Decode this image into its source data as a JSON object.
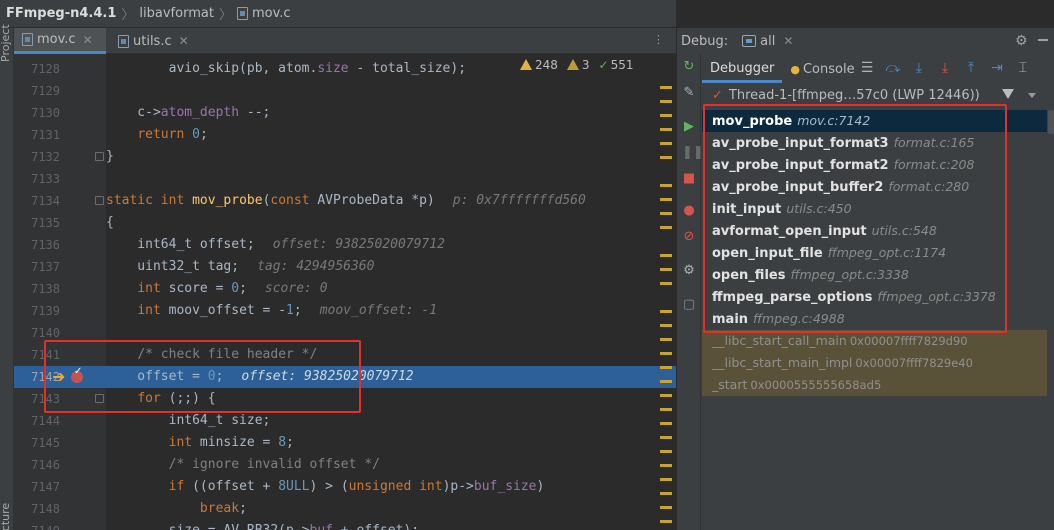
{
  "breadcrumb": {
    "project": "FFmpeg-n4.4.1",
    "folder": "libavformat",
    "file": "mov.c"
  },
  "side_strip": {
    "project_label": "Project",
    "bottom_label": "Structure"
  },
  "editor_tabs": [
    {
      "label": "mov.c",
      "active": true
    },
    {
      "label": "utils.c",
      "active": false
    }
  ],
  "inspections": {
    "warnings": "248",
    "weak_warnings": "3",
    "typos": "551"
  },
  "code_lines": [
    {
      "num": "7128",
      "html": "        avio_skip(pb, atom.<span class='field'>size</span> - total_size);"
    },
    {
      "num": "7129",
      "html": ""
    },
    {
      "num": "7130",
      "html": "    c-><span class='field'>atom_depth</span> --;"
    },
    {
      "num": "7131",
      "html": "    <span class='kw'>return</span> <span class='num'>0</span>;"
    },
    {
      "num": "7132",
      "html": "}"
    },
    {
      "num": "7133",
      "html": ""
    },
    {
      "num": "7134",
      "html": "<span class='kw'>static int</span> <span class='fn'>mov_probe</span>(<span class='kw'>const</span> AVProbeData *p)<span class='hint'>p: 0x7fffffffd560</span>"
    },
    {
      "num": "7135",
      "html": "{"
    },
    {
      "num": "7136",
      "html": "    int64_t offset;<span class='hint'>offset: 93825020079712</span>"
    },
    {
      "num": "7137",
      "html": "    uint32_t tag;<span class='hint'>tag: 4294956360</span>"
    },
    {
      "num": "7138",
      "html": "    <span class='kw'>int</span> score = <span class='num'>0</span>;<span class='hint'>score: 0</span>"
    },
    {
      "num": "7139",
      "html": "    <span class='kw'>int</span> moov_offset = -<span class='num'>1</span>;<span class='hint'>moov_offset: -1</span>"
    },
    {
      "num": "7140",
      "html": ""
    },
    {
      "num": "7141",
      "html": "    <span class='cm'>/* check file header */</span>"
    },
    {
      "num": "7142",
      "html": "    offset = <span class='num'>0</span>;<span class='hint'>offset: 93825020079712</span>"
    },
    {
      "num": "7143",
      "html": "    <span class='kw'>for</span> (;;) {"
    },
    {
      "num": "7144",
      "html": "        int64_t size;"
    },
    {
      "num": "7145",
      "html": "        <span class='kw'>int</span> minsize = <span class='num'>8</span>;"
    },
    {
      "num": "7146",
      "html": "        <span class='cm'>/* ignore invalid offset */</span>"
    },
    {
      "num": "7147",
      "html": "        <span class='kw'>if</span> ((offset + <span class='num'>8ULL</span>) > (<span class='kw'>unsigned int</span>)p-><span class='field'>buf_size</span>)"
    },
    {
      "num": "7148",
      "html": "            <span class='kw'>break</span>;"
    },
    {
      "num": "7149",
      "html": "        size = AV_RB32(p-><span class='field'>buf</span> + offset);"
    }
  ],
  "debug": {
    "title": "Debug:",
    "session": "all",
    "tabs": [
      "Debugger",
      "Console"
    ],
    "thread": "Thread-1-[ffmpeg…57c0 (LWP 12446))"
  },
  "frames": [
    {
      "name": "mov_probe",
      "loc": "mov.c:7142",
      "kind": "sel"
    },
    {
      "name": "av_probe_input_format3",
      "loc": "format.c:165",
      "kind": "user"
    },
    {
      "name": "av_probe_input_format2",
      "loc": "format.c:208",
      "kind": "user"
    },
    {
      "name": "av_probe_input_buffer2",
      "loc": "format.c:280",
      "kind": "user"
    },
    {
      "name": "init_input",
      "loc": "utils.c:450",
      "kind": "user"
    },
    {
      "name": "avformat_open_input",
      "loc": "utils.c:548",
      "kind": "user"
    },
    {
      "name": "open_input_file",
      "loc": "ffmpeg_opt.c:1174",
      "kind": "user"
    },
    {
      "name": "open_files",
      "loc": "ffmpeg_opt.c:3338",
      "kind": "user"
    },
    {
      "name": "ffmpeg_parse_options",
      "loc": "ffmpeg_opt.c:3378",
      "kind": "user"
    },
    {
      "name": "main",
      "loc": "ffmpeg.c:4988",
      "kind": "user"
    },
    {
      "name": "__libc_start_call_main",
      "loc": "0x00007ffff7829d90",
      "kind": "lib"
    },
    {
      "name": "__libc_start_main_impl",
      "loc": "0x00007ffff7829e40",
      "kind": "lib"
    },
    {
      "name": "_start",
      "loc": "0x0000555555658ad5",
      "kind": "lib"
    }
  ],
  "colors": {
    "highlight_line": "#2d6099",
    "selected_frame": "#0d293e",
    "library_frame": "#595238",
    "annotation_box": "#e5302a"
  }
}
